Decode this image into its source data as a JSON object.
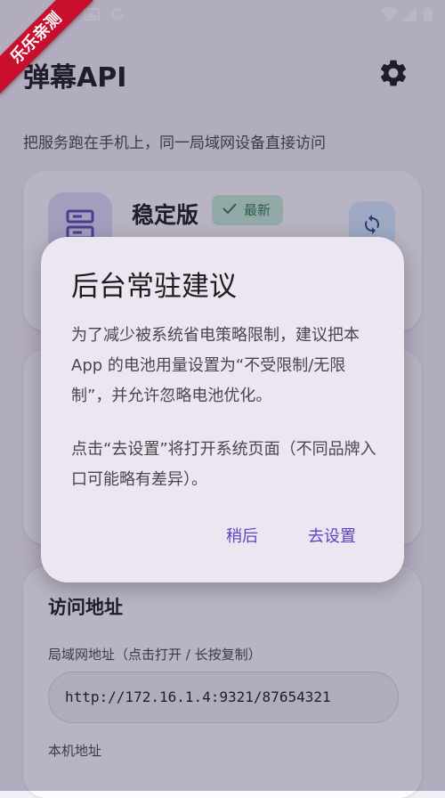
{
  "status_bar": {
    "left_icons": [
      "photo-icon",
      "sync-icon"
    ],
    "right_icons": [
      "wifi-icon",
      "signal-icon",
      "battery-icon"
    ]
  },
  "watermark": {
    "text": "乐乐亲测",
    "color": "#c8102e"
  },
  "app": {
    "title": "弹幕API",
    "settings_icon": "gear-icon"
  },
  "subtitle": "把服务跑在手机上，同一局域网设备直接访问",
  "card_version": {
    "title": "稳定版",
    "badge": "最新",
    "badge_color": "#2e7d4f"
  },
  "card_access": {
    "title": "访问地址",
    "lan_label": "局域网地址（点击打开 / 长按复制）",
    "lan_url": "http://172.16.1.4:9321/87654321",
    "local_label": "本机地址"
  },
  "dialog": {
    "title": "后台常驻建议",
    "paragraph1": "为了减少被系统省电策略限制，建议把本 App 的电池用量设置为“不受限制/无限制”，并允许忽略电池优化。",
    "paragraph2": "点击“去设置”将打开系统页面（不同品牌入口可能略有差异）。",
    "later_button": "稍后",
    "settings_button": "去设置",
    "accent_color": "#5b45c7"
  }
}
